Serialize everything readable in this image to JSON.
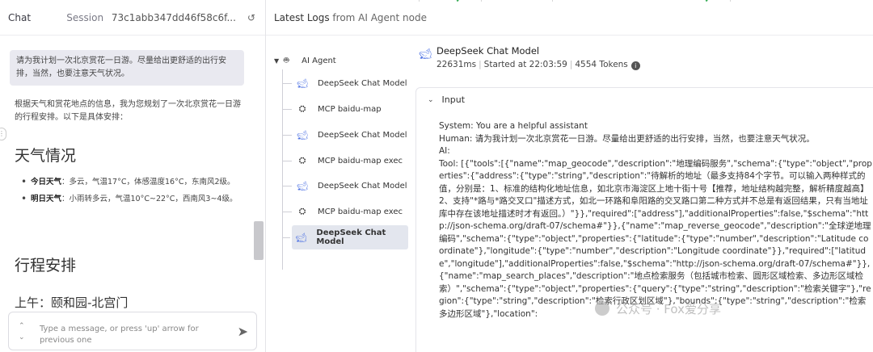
{
  "chat": {
    "title": "Chat",
    "session_label": "Session",
    "session_id": "73c1abb347dd46f58c6f...",
    "reset_icon": "refresh-icon",
    "user_message": "请为我计划一次北京赏花一日游。尽量给出更舒适的出行安排，当然，也要注意天气状况。",
    "bot_intro": "根据天气和赏花地点的信息，我为您规划了一次北京赏花一日游的行程安排。以下是具体安排：",
    "weather_heading": "天气情况",
    "weather_items": [
      {
        "label": "今日天气",
        "text": "：多云，气温17°C，体感温度16°C，东南风2级。"
      },
      {
        "label": "明日天气",
        "text": "：小雨转多云，气温10°C~22°C，西南风3~4级。"
      }
    ],
    "plan_heading": "行程安排",
    "morning_heading": "上午：颐和园-北宫门",
    "input_placeholder": "Type a message, or press 'up' arrow for previous one",
    "send_icon": "send-icon"
  },
  "logs": {
    "title_prefix": "Latest Logs",
    "title_suffix": "from AI Agent node"
  },
  "tree": {
    "root": {
      "label": "AI Agent",
      "icon": "robot-icon"
    },
    "children": [
      {
        "label": "DeepSeek Chat Model",
        "icon": "deepseek-icon",
        "selected": false
      },
      {
        "label": "MCP baidu-map",
        "icon": "mcp-icon",
        "selected": false
      },
      {
        "label": "DeepSeek Chat Model",
        "icon": "deepseek-icon",
        "selected": false
      },
      {
        "label": "MCP baidu-map exec",
        "icon": "mcp-icon",
        "selected": false
      },
      {
        "label": "DeepSeek Chat Model",
        "icon": "deepseek-icon",
        "selected": false
      },
      {
        "label": "MCP baidu-map exec",
        "icon": "mcp-icon",
        "selected": false
      },
      {
        "label": "DeepSeek Chat Model",
        "icon": "deepseek-icon",
        "selected": true
      }
    ]
  },
  "detail": {
    "model_name": "DeepSeek Chat Model",
    "duration": "22631ms",
    "started": "Started at 22:03:59",
    "tokens": "4554 Tokens",
    "input_label": "Input",
    "input_text": "System: You are a helpful assistant\nHuman: 请为我计划一次北京赏花一日游。尽量给出更舒适的出行安排，当然，也要注意天气状况。\nAI:\nTool: [{\"tools\":[{\"name\":\"map_geocode\",\"description\":\"地理编码服务\",\"schema\":{\"type\":\"object\",\"properties\":{\"address\":{\"type\":\"string\",\"description\":\"待解析的地址（最多支持84个字节。可以输入两种样式的值，分别是：1、标准的结构化地址信息，如北京市海淀区上地十街十号【推荐，地址结构越完整，解析精度越高】2、支持\"*路与*路交叉口\"描述方式，如北一环路和阜阳路的交叉路口第二种方式并不总是有返回结果，只有当地址库中存在该地址描述时才有返回。）\"}},\"required\":[\"address\"],\"additionalProperties\":false,\"$schema\":\"http://json-schema.org/draft-07/schema#\"}},{\"name\":\"map_reverse_geocode\",\"description\":\"全球逆地理编码\",\"schema\":{\"type\":\"object\",\"properties\":{\"latitude\":{\"type\":\"number\",\"description\":\"Latitude coordinate\"},\"longitude\":{\"type\":\"number\",\"description\":\"Longitude coordinate\"}},\"required\":[\"latitude\",\"longitude\"],\"additionalProperties\":false,\"$schema\":\"http://json-schema.org/draft-07/schema#\"}},{\"name\":\"map_search_places\",\"description\":\"地点检索服务（包括城市检索、圆形区域检索、多边形区域检索）\",\"schema\":{\"type\":\"object\",\"properties\":{\"query\":{\"type\":\"string\",\"description\":\"检索关键字\"},\"region\":{\"type\":\"string\",\"description\":\"检索行政区划区域\"},\"bounds\":{\"type\":\"string\",\"description\":\"检索多边形区域\"},\"location\":"
  },
  "watermark": "公众号 · Fox爱分享"
}
